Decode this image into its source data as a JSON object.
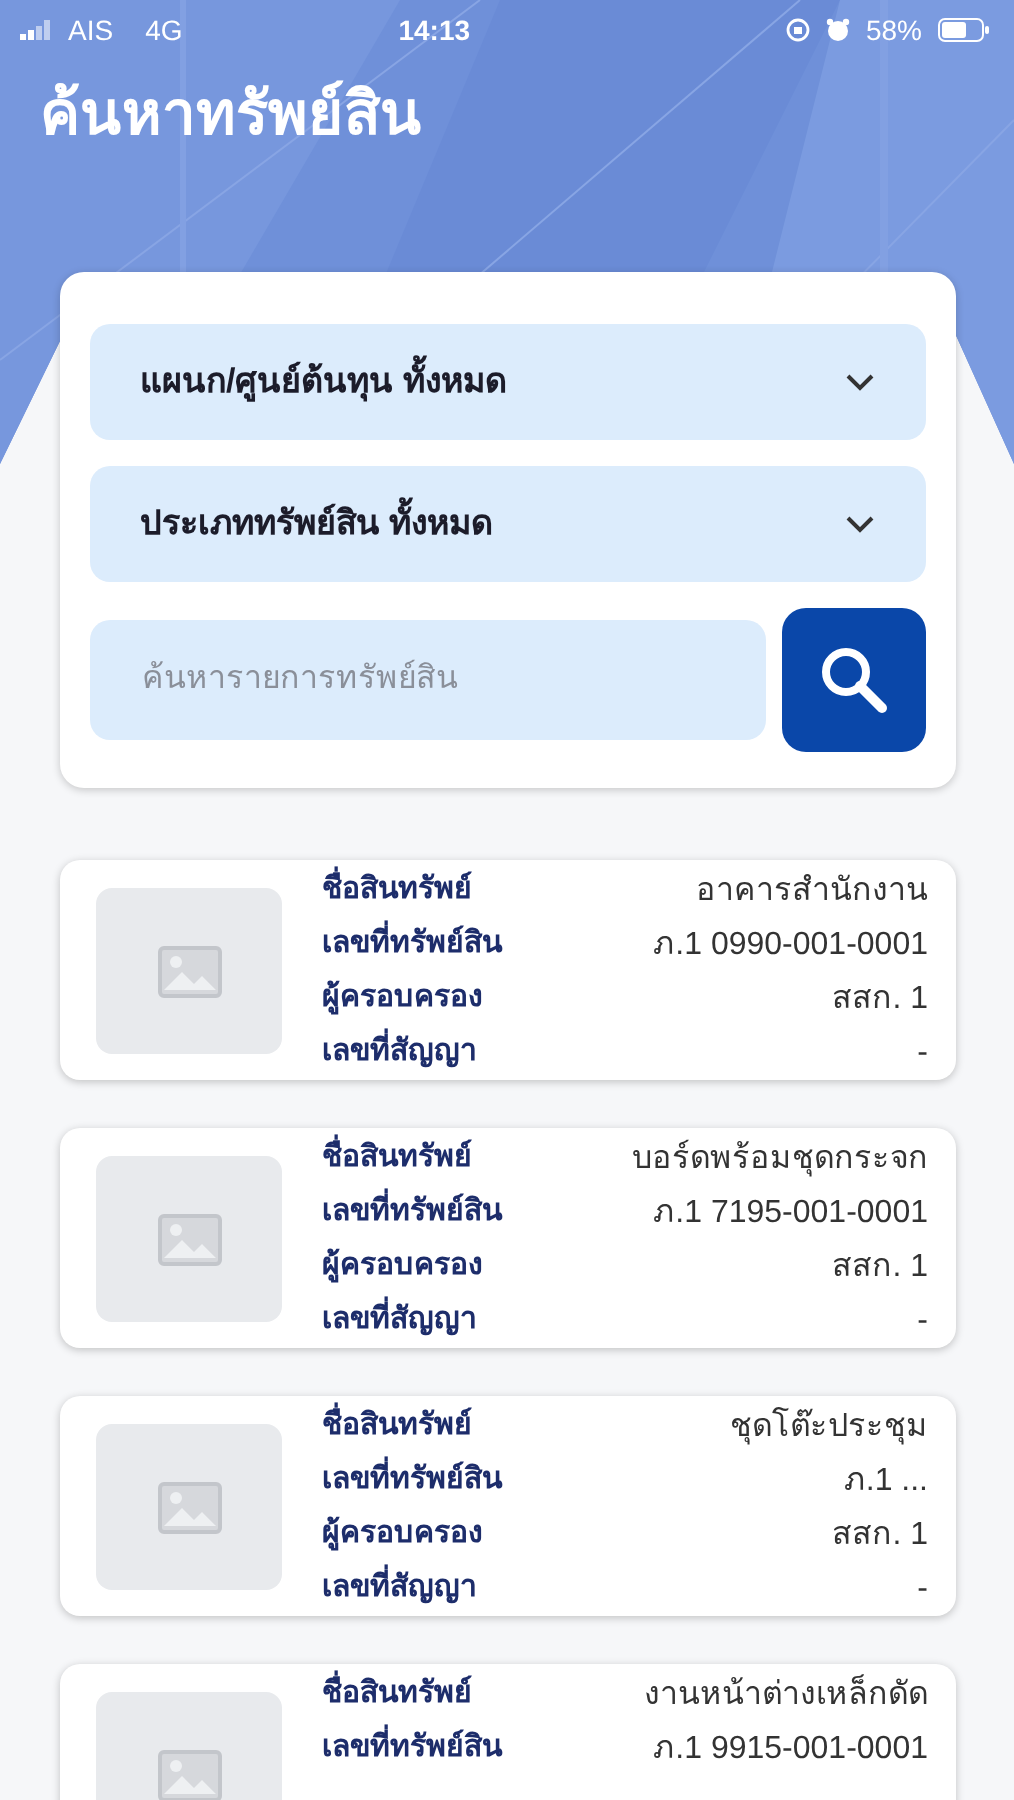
{
  "status_bar": {
    "carrier": "AIS",
    "network": "4G",
    "time": "14:13",
    "battery_text": "58%"
  },
  "title": "ค้นหาทรัพย์สิน",
  "filters": [
    {
      "label": "แผนก/ศูนย์ต้นทุน ทั้งหมด"
    },
    {
      "label": "ประเภททรัพย์สิน ทั้งหมด"
    }
  ],
  "search": {
    "placeholder": "ค้นหารายการทรัพย์สิน"
  },
  "assets": [
    {
      "rows": [
        {
          "label": "ชื่อสินทรัพย์",
          "value": "อาคารสำนักงาน"
        },
        {
          "label": "เลขที่ทรัพย์สิน",
          "value": "ภ.1 0990-001-0001"
        },
        {
          "label": "ผู้ครอบครอง",
          "value": "สสก. 1"
        },
        {
          "label": "เลขที่สัญญา",
          "value": "-"
        }
      ]
    },
    {
      "rows": [
        {
          "label": "ชื่อสินทรัพย์",
          "value": "บอร์ดพร้อมชุดกระจก"
        },
        {
          "label": "เลขที่ทรัพย์สิน",
          "value": "ภ.1 7195-001-0001"
        },
        {
          "label": "ผู้ครอบครอง",
          "value": "สสก. 1"
        },
        {
          "label": "เลขที่สัญญา",
          "value": "-"
        }
      ]
    },
    {
      "rows": [
        {
          "label": "ชื่อสินทรัพย์",
          "value": "ชุดโต๊ะประชุม"
        },
        {
          "label": "เลขที่ทรัพย์สิน",
          "value": "ภ.1 ..."
        },
        {
          "label": "ผู้ครอบครอง",
          "value": "สสก. 1"
        },
        {
          "label": "เลขที่สัญญา",
          "value": "-"
        }
      ]
    },
    {
      "rows": [
        {
          "label": "ชื่อสินทรัพย์",
          "value": "งานหน้าต่างเหล็กดัด"
        },
        {
          "label": "เลขที่ทรัพย์สิน",
          "value": "ภ.1 9915-001-0001"
        }
      ]
    }
  ]
}
